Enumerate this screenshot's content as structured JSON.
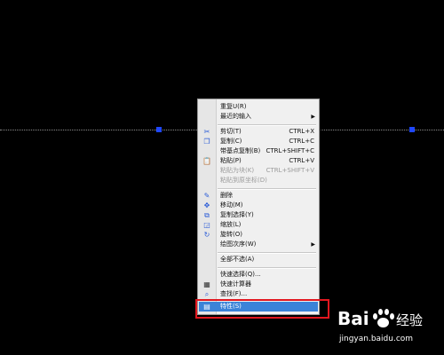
{
  "colors": {
    "background": "#000000",
    "grip": "#1f47ff",
    "menu_bg": "#f0f0f0",
    "selected": "#3b83d8",
    "highlight_box": "#e2171f"
  },
  "context_menu": {
    "items": [
      {
        "label": "重复U(R)",
        "icon": "",
        "shortcut": "",
        "submenu": false,
        "disabled": false
      },
      {
        "label": "最近的输入",
        "icon": "",
        "shortcut": "",
        "submenu": true,
        "disabled": false
      },
      {
        "label": "剪切(T)",
        "icon": "scissors-icon",
        "shortcut": "CTRL+X",
        "submenu": false,
        "disabled": false
      },
      {
        "label": "复制(C)",
        "icon": "copy-icon",
        "shortcut": "CTRL+C",
        "submenu": false,
        "disabled": false
      },
      {
        "label": "带基点复制(B)",
        "icon": "",
        "shortcut": "CTRL+SHIFT+C",
        "submenu": false,
        "disabled": false
      },
      {
        "label": "粘贴(P)",
        "icon": "paste-icon",
        "shortcut": "CTRL+V",
        "submenu": false,
        "disabled": false
      },
      {
        "label": "粘贴为块(K)",
        "icon": "",
        "shortcut": "CTRL+SHIFT+V",
        "submenu": false,
        "disabled": true
      },
      {
        "label": "粘贴到原坐标(D)",
        "icon": "",
        "shortcut": "",
        "submenu": false,
        "disabled": true
      },
      {
        "label": "删除",
        "icon": "erase-icon",
        "shortcut": "",
        "submenu": false,
        "disabled": false
      },
      {
        "label": "移动(M)",
        "icon": "move-icon",
        "shortcut": "",
        "submenu": false,
        "disabled": false
      },
      {
        "label": "复制选择(Y)",
        "icon": "copy-selection-icon",
        "shortcut": "",
        "submenu": false,
        "disabled": false
      },
      {
        "label": "缩放(L)",
        "icon": "scale-icon",
        "shortcut": "",
        "submenu": false,
        "disabled": false
      },
      {
        "label": "旋转(O)",
        "icon": "rotate-icon",
        "shortcut": "",
        "submenu": false,
        "disabled": false
      },
      {
        "label": "绘图次序(W)",
        "icon": "",
        "shortcut": "",
        "submenu": true,
        "disabled": false
      },
      {
        "label": "全部不选(A)",
        "icon": "",
        "shortcut": "",
        "submenu": false,
        "disabled": false
      },
      {
        "label": "快速选择(Q)...",
        "icon": "",
        "shortcut": "",
        "submenu": false,
        "disabled": false
      },
      {
        "label": "快速计算器",
        "icon": "calculator-icon",
        "shortcut": "",
        "submenu": false,
        "disabled": false
      },
      {
        "label": "查找(F)...",
        "icon": "find-icon",
        "shortcut": "",
        "submenu": false,
        "disabled": false
      },
      {
        "label": "特性(S)",
        "icon": "properties-icon",
        "shortcut": "",
        "submenu": false,
        "disabled": false,
        "selected": true
      }
    ]
  },
  "watermark": {
    "brand_a": "Bai",
    "brand_b": "经验",
    "url": "jingyan.baidu.com"
  }
}
